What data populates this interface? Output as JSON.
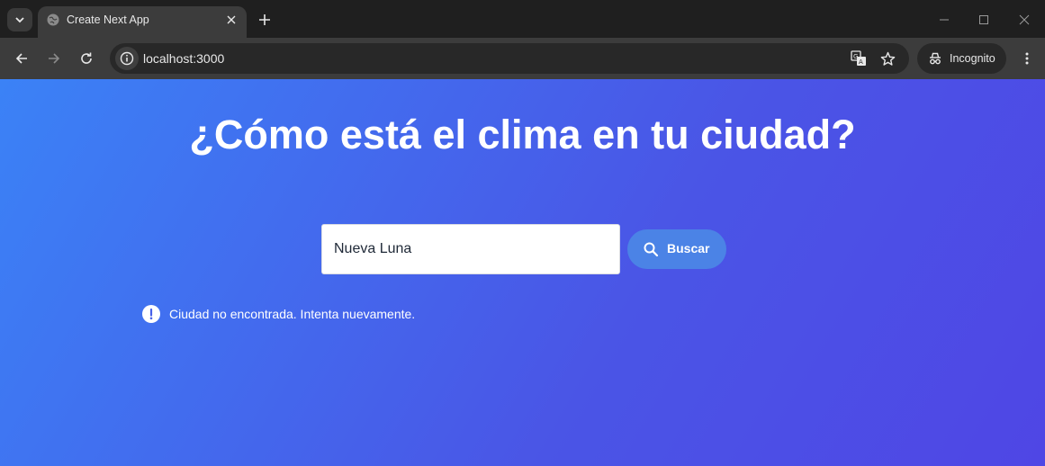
{
  "browser": {
    "tab_title": "Create Next App",
    "url": "localhost:3000",
    "incognito_label": "Incognito"
  },
  "main": {
    "heading": "¿Cómo está el clima en tu ciudad?",
    "search": {
      "value": "Nueva Luna",
      "button_label": "Buscar"
    },
    "error_message": "Ciudad no encontrada. Intenta nuevamente."
  },
  "colors": {
    "gradient_start": "#3b82f6",
    "gradient_end": "#4f46e5",
    "button_bg": "#4b83e6"
  },
  "icons": [
    "chevron-down-icon",
    "globe-icon",
    "close-icon",
    "plus-icon",
    "minimize-icon",
    "maximize-icon",
    "back-icon",
    "forward-icon",
    "reload-icon",
    "info-icon",
    "translate-icon",
    "star-icon",
    "incognito-icon",
    "more-vert-icon",
    "search-icon",
    "alert-icon"
  ]
}
